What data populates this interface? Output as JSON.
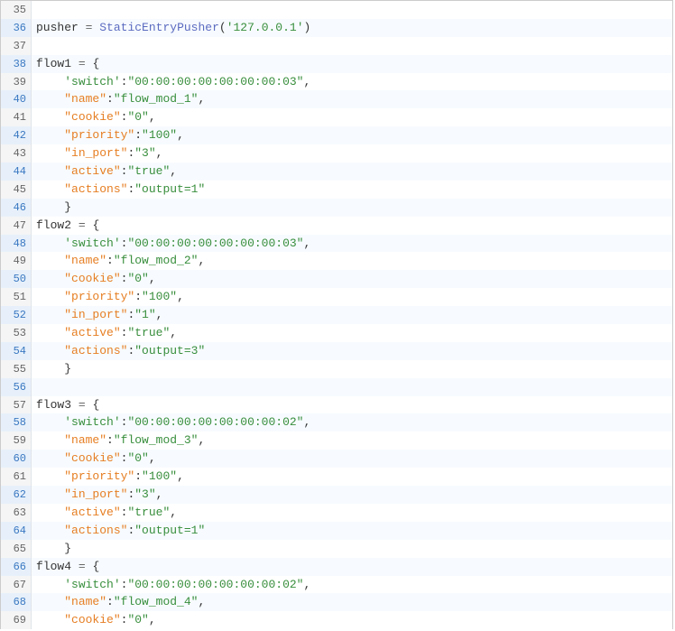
{
  "lines": [
    {
      "num": 35,
      "tokens": []
    },
    {
      "num": 36,
      "tokens": [
        {
          "t": "pusher",
          "c": "t-var"
        },
        {
          "t": " ",
          "c": "t-plain"
        },
        {
          "t": "=",
          "c": "t-op"
        },
        {
          "t": " ",
          "c": "t-plain"
        },
        {
          "t": "StaticEntryPusher",
          "c": "t-func"
        },
        {
          "t": "(",
          "c": "t-paren"
        },
        {
          "t": "'127.0.0.1'",
          "c": "t-str"
        },
        {
          "t": ")",
          "c": "t-paren"
        }
      ]
    },
    {
      "num": 37,
      "tokens": []
    },
    {
      "num": 38,
      "tokens": [
        {
          "t": "flow1",
          "c": "t-var"
        },
        {
          "t": " ",
          "c": "t-plain"
        },
        {
          "t": "=",
          "c": "t-op"
        },
        {
          "t": " ",
          "c": "t-plain"
        },
        {
          "t": "{",
          "c": "t-brace"
        }
      ]
    },
    {
      "num": 39,
      "tokens": [
        {
          "t": "    ",
          "c": "t-plain"
        },
        {
          "t": "'switch'",
          "c": "t-str"
        },
        {
          "t": ":",
          "c": "t-plain"
        },
        {
          "t": "\"00:00:00:00:00:00:00:03\"",
          "c": "t-str"
        },
        {
          "t": ",",
          "c": "t-comma"
        }
      ]
    },
    {
      "num": 40,
      "tokens": [
        {
          "t": "    ",
          "c": "t-plain"
        },
        {
          "t": "\"name\"",
          "c": "t-key"
        },
        {
          "t": ":",
          "c": "t-plain"
        },
        {
          "t": "\"flow_mod_1\"",
          "c": "t-str"
        },
        {
          "t": ",",
          "c": "t-comma"
        }
      ]
    },
    {
      "num": 41,
      "tokens": [
        {
          "t": "    ",
          "c": "t-plain"
        },
        {
          "t": "\"cookie\"",
          "c": "t-key"
        },
        {
          "t": ":",
          "c": "t-plain"
        },
        {
          "t": "\"0\"",
          "c": "t-str"
        },
        {
          "t": ",",
          "c": "t-comma"
        }
      ]
    },
    {
      "num": 42,
      "tokens": [
        {
          "t": "    ",
          "c": "t-plain"
        },
        {
          "t": "\"priority\"",
          "c": "t-key"
        },
        {
          "t": ":",
          "c": "t-plain"
        },
        {
          "t": "\"100\"",
          "c": "t-str"
        },
        {
          "t": ",",
          "c": "t-comma"
        }
      ]
    },
    {
      "num": 43,
      "tokens": [
        {
          "t": "    ",
          "c": "t-plain"
        },
        {
          "t": "\"in_port\"",
          "c": "t-key"
        },
        {
          "t": ":",
          "c": "t-plain"
        },
        {
          "t": "\"3\"",
          "c": "t-str"
        },
        {
          "t": ",",
          "c": "t-comma"
        }
      ]
    },
    {
      "num": 44,
      "tokens": [
        {
          "t": "    ",
          "c": "t-plain"
        },
        {
          "t": "\"active\"",
          "c": "t-key"
        },
        {
          "t": ":",
          "c": "t-plain"
        },
        {
          "t": "\"true\"",
          "c": "t-str"
        },
        {
          "t": ",",
          "c": "t-comma"
        }
      ]
    },
    {
      "num": 45,
      "tokens": [
        {
          "t": "    ",
          "c": "t-plain"
        },
        {
          "t": "\"actions\"",
          "c": "t-key"
        },
        {
          "t": ":",
          "c": "t-plain"
        },
        {
          "t": "\"output=1\"",
          "c": "t-str"
        }
      ]
    },
    {
      "num": 46,
      "tokens": [
        {
          "t": "    ",
          "c": "t-plain"
        },
        {
          "t": "}",
          "c": "t-brace"
        }
      ]
    },
    {
      "num": 47,
      "tokens": [
        {
          "t": "flow2",
          "c": "t-var"
        },
        {
          "t": " ",
          "c": "t-plain"
        },
        {
          "t": "=",
          "c": "t-op"
        },
        {
          "t": " ",
          "c": "t-plain"
        },
        {
          "t": "{",
          "c": "t-brace"
        }
      ]
    },
    {
      "num": 48,
      "tokens": [
        {
          "t": "    ",
          "c": "t-plain"
        },
        {
          "t": "'switch'",
          "c": "t-str"
        },
        {
          "t": ":",
          "c": "t-plain"
        },
        {
          "t": "\"00:00:00:00:00:00:00:03\"",
          "c": "t-str"
        },
        {
          "t": ",",
          "c": "t-comma"
        }
      ]
    },
    {
      "num": 49,
      "tokens": [
        {
          "t": "    ",
          "c": "t-plain"
        },
        {
          "t": "\"name\"",
          "c": "t-key"
        },
        {
          "t": ":",
          "c": "t-plain"
        },
        {
          "t": "\"flow_mod_2\"",
          "c": "t-str"
        },
        {
          "t": ",",
          "c": "t-comma"
        }
      ]
    },
    {
      "num": 50,
      "tokens": [
        {
          "t": "    ",
          "c": "t-plain"
        },
        {
          "t": "\"cookie\"",
          "c": "t-key"
        },
        {
          "t": ":",
          "c": "t-plain"
        },
        {
          "t": "\"0\"",
          "c": "t-str"
        },
        {
          "t": ",",
          "c": "t-comma"
        }
      ]
    },
    {
      "num": 51,
      "tokens": [
        {
          "t": "    ",
          "c": "t-plain"
        },
        {
          "t": "\"priority\"",
          "c": "t-key"
        },
        {
          "t": ":",
          "c": "t-plain"
        },
        {
          "t": "\"100\"",
          "c": "t-str"
        },
        {
          "t": ",",
          "c": "t-comma"
        }
      ]
    },
    {
      "num": 52,
      "tokens": [
        {
          "t": "    ",
          "c": "t-plain"
        },
        {
          "t": "\"in_port\"",
          "c": "t-key"
        },
        {
          "t": ":",
          "c": "t-plain"
        },
        {
          "t": "\"1\"",
          "c": "t-str"
        },
        {
          "t": ",",
          "c": "t-comma"
        }
      ]
    },
    {
      "num": 53,
      "tokens": [
        {
          "t": "    ",
          "c": "t-plain"
        },
        {
          "t": "\"active\"",
          "c": "t-key"
        },
        {
          "t": ":",
          "c": "t-plain"
        },
        {
          "t": "\"true\"",
          "c": "t-str"
        },
        {
          "t": ",",
          "c": "t-comma"
        }
      ]
    },
    {
      "num": 54,
      "tokens": [
        {
          "t": "    ",
          "c": "t-plain"
        },
        {
          "t": "\"actions\"",
          "c": "t-key"
        },
        {
          "t": ":",
          "c": "t-plain"
        },
        {
          "t": "\"output=3\"",
          "c": "t-str"
        }
      ]
    },
    {
      "num": 55,
      "tokens": [
        {
          "t": "    ",
          "c": "t-plain"
        },
        {
          "t": "}",
          "c": "t-brace"
        }
      ]
    },
    {
      "num": 56,
      "tokens": []
    },
    {
      "num": 57,
      "tokens": [
        {
          "t": "flow3",
          "c": "t-var"
        },
        {
          "t": " ",
          "c": "t-plain"
        },
        {
          "t": "=",
          "c": "t-op"
        },
        {
          "t": " ",
          "c": "t-plain"
        },
        {
          "t": "{",
          "c": "t-brace"
        }
      ]
    },
    {
      "num": 58,
      "tokens": [
        {
          "t": "    ",
          "c": "t-plain"
        },
        {
          "t": "'switch'",
          "c": "t-str"
        },
        {
          "t": ":",
          "c": "t-plain"
        },
        {
          "t": "\"00:00:00:00:00:00:00:02\"",
          "c": "t-str"
        },
        {
          "t": ",",
          "c": "t-comma"
        }
      ]
    },
    {
      "num": 59,
      "tokens": [
        {
          "t": "    ",
          "c": "t-plain"
        },
        {
          "t": "\"name\"",
          "c": "t-key"
        },
        {
          "t": ":",
          "c": "t-plain"
        },
        {
          "t": "\"flow_mod_3\"",
          "c": "t-str"
        },
        {
          "t": ",",
          "c": "t-comma"
        }
      ]
    },
    {
      "num": 60,
      "tokens": [
        {
          "t": "    ",
          "c": "t-plain"
        },
        {
          "t": "\"cookie\"",
          "c": "t-key"
        },
        {
          "t": ":",
          "c": "t-plain"
        },
        {
          "t": "\"0\"",
          "c": "t-str"
        },
        {
          "t": ",",
          "c": "t-comma"
        }
      ]
    },
    {
      "num": 61,
      "tokens": [
        {
          "t": "    ",
          "c": "t-plain"
        },
        {
          "t": "\"priority\"",
          "c": "t-key"
        },
        {
          "t": ":",
          "c": "t-plain"
        },
        {
          "t": "\"100\"",
          "c": "t-str"
        },
        {
          "t": ",",
          "c": "t-comma"
        }
      ]
    },
    {
      "num": 62,
      "tokens": [
        {
          "t": "    ",
          "c": "t-plain"
        },
        {
          "t": "\"in_port\"",
          "c": "t-key"
        },
        {
          "t": ":",
          "c": "t-plain"
        },
        {
          "t": "\"3\"",
          "c": "t-str"
        },
        {
          "t": ",",
          "c": "t-comma"
        }
      ]
    },
    {
      "num": 63,
      "tokens": [
        {
          "t": "    ",
          "c": "t-plain"
        },
        {
          "t": "\"active\"",
          "c": "t-key"
        },
        {
          "t": ":",
          "c": "t-plain"
        },
        {
          "t": "\"true\"",
          "c": "t-str"
        },
        {
          "t": ",",
          "c": "t-comma"
        }
      ]
    },
    {
      "num": 64,
      "tokens": [
        {
          "t": "    ",
          "c": "t-plain"
        },
        {
          "t": "\"actions\"",
          "c": "t-key"
        },
        {
          "t": ":",
          "c": "t-plain"
        },
        {
          "t": "\"output=1\"",
          "c": "t-str"
        }
      ]
    },
    {
      "num": 65,
      "tokens": [
        {
          "t": "    ",
          "c": "t-plain"
        },
        {
          "t": "}",
          "c": "t-brace"
        }
      ]
    },
    {
      "num": 66,
      "tokens": [
        {
          "t": "flow4",
          "c": "t-var"
        },
        {
          "t": " ",
          "c": "t-plain"
        },
        {
          "t": "=",
          "c": "t-op"
        },
        {
          "t": " ",
          "c": "t-plain"
        },
        {
          "t": "{",
          "c": "t-brace"
        }
      ]
    },
    {
      "num": 67,
      "tokens": [
        {
          "t": "    ",
          "c": "t-plain"
        },
        {
          "t": "'switch'",
          "c": "t-str"
        },
        {
          "t": ":",
          "c": "t-plain"
        },
        {
          "t": "\"00:00:00:00:00:00:00:02\"",
          "c": "t-str"
        },
        {
          "t": ",",
          "c": "t-comma"
        }
      ]
    },
    {
      "num": 68,
      "tokens": [
        {
          "t": "    ",
          "c": "t-plain"
        },
        {
          "t": "\"name\"",
          "c": "t-key"
        },
        {
          "t": ":",
          "c": "t-plain"
        },
        {
          "t": "\"flow_mod_4\"",
          "c": "t-str"
        },
        {
          "t": ",",
          "c": "t-comma"
        }
      ]
    },
    {
      "num": 69,
      "tokens": [
        {
          "t": "    ",
          "c": "t-plain"
        },
        {
          "t": "\"cookie\"",
          "c": "t-key"
        },
        {
          "t": ":",
          "c": "t-plain"
        },
        {
          "t": "\"0\"",
          "c": "t-str"
        },
        {
          "t": ",",
          "c": "t-comma"
        }
      ]
    }
  ]
}
